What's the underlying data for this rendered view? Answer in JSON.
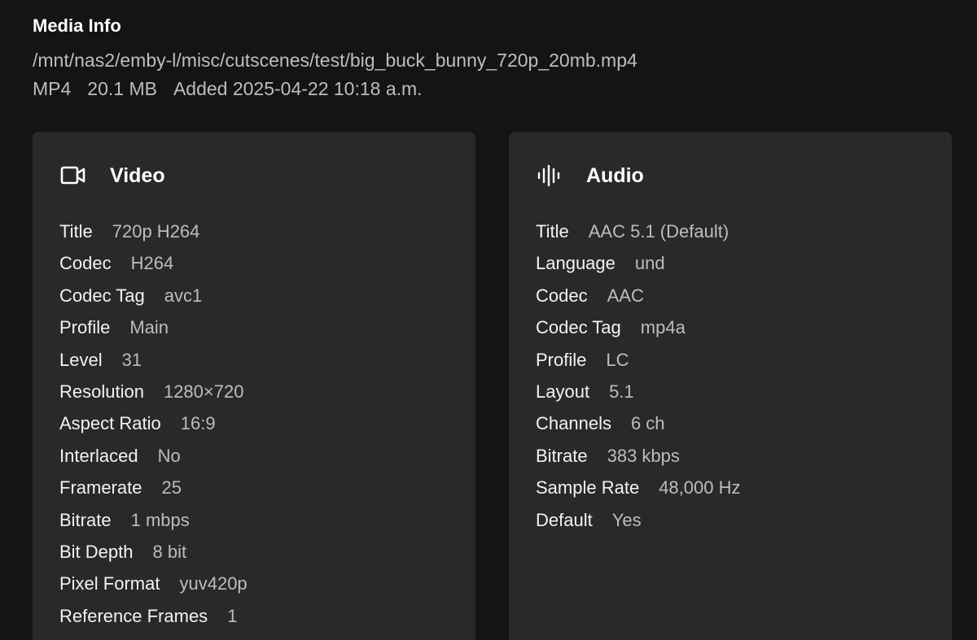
{
  "header": {
    "title": "Media Info",
    "path": "/mnt/nas2/emby-l/misc/cutscenes/test/big_buck_bunny_720p_20mb.mp4",
    "container": "MP4",
    "size": "20.1 MB",
    "added": "Added 2025-04-22 10:18 a.m."
  },
  "video": {
    "title": "Video",
    "icon": "video-camera-icon",
    "rows": [
      {
        "label": "Title",
        "value": "720p H264"
      },
      {
        "label": "Codec",
        "value": "H264"
      },
      {
        "label": "Codec Tag",
        "value": "avc1"
      },
      {
        "label": "Profile",
        "value": "Main"
      },
      {
        "label": "Level",
        "value": "31"
      },
      {
        "label": "Resolution",
        "value": "1280×720"
      },
      {
        "label": "Aspect Ratio",
        "value": "16:9"
      },
      {
        "label": "Interlaced",
        "value": "No"
      },
      {
        "label": "Framerate",
        "value": "25"
      },
      {
        "label": "Bitrate",
        "value": "1 mbps"
      },
      {
        "label": "Bit Depth",
        "value": "8 bit"
      },
      {
        "label": "Pixel Format",
        "value": "yuv420p"
      },
      {
        "label": "Reference Frames",
        "value": "1"
      }
    ]
  },
  "audio": {
    "title": "Audio",
    "icon": "audio-waveform-icon",
    "rows": [
      {
        "label": "Title",
        "value": "AAC 5.1 (Default)"
      },
      {
        "label": "Language",
        "value": "und"
      },
      {
        "label": "Codec",
        "value": "AAC"
      },
      {
        "label": "Codec Tag",
        "value": "mp4a"
      },
      {
        "label": "Profile",
        "value": "LC"
      },
      {
        "label": "Layout",
        "value": "5.1"
      },
      {
        "label": "Channels",
        "value": "6 ch"
      },
      {
        "label": "Bitrate",
        "value": "383 kbps"
      },
      {
        "label": "Sample Rate",
        "value": "48,000 Hz"
      },
      {
        "label": "Default",
        "value": "Yes"
      }
    ]
  }
}
